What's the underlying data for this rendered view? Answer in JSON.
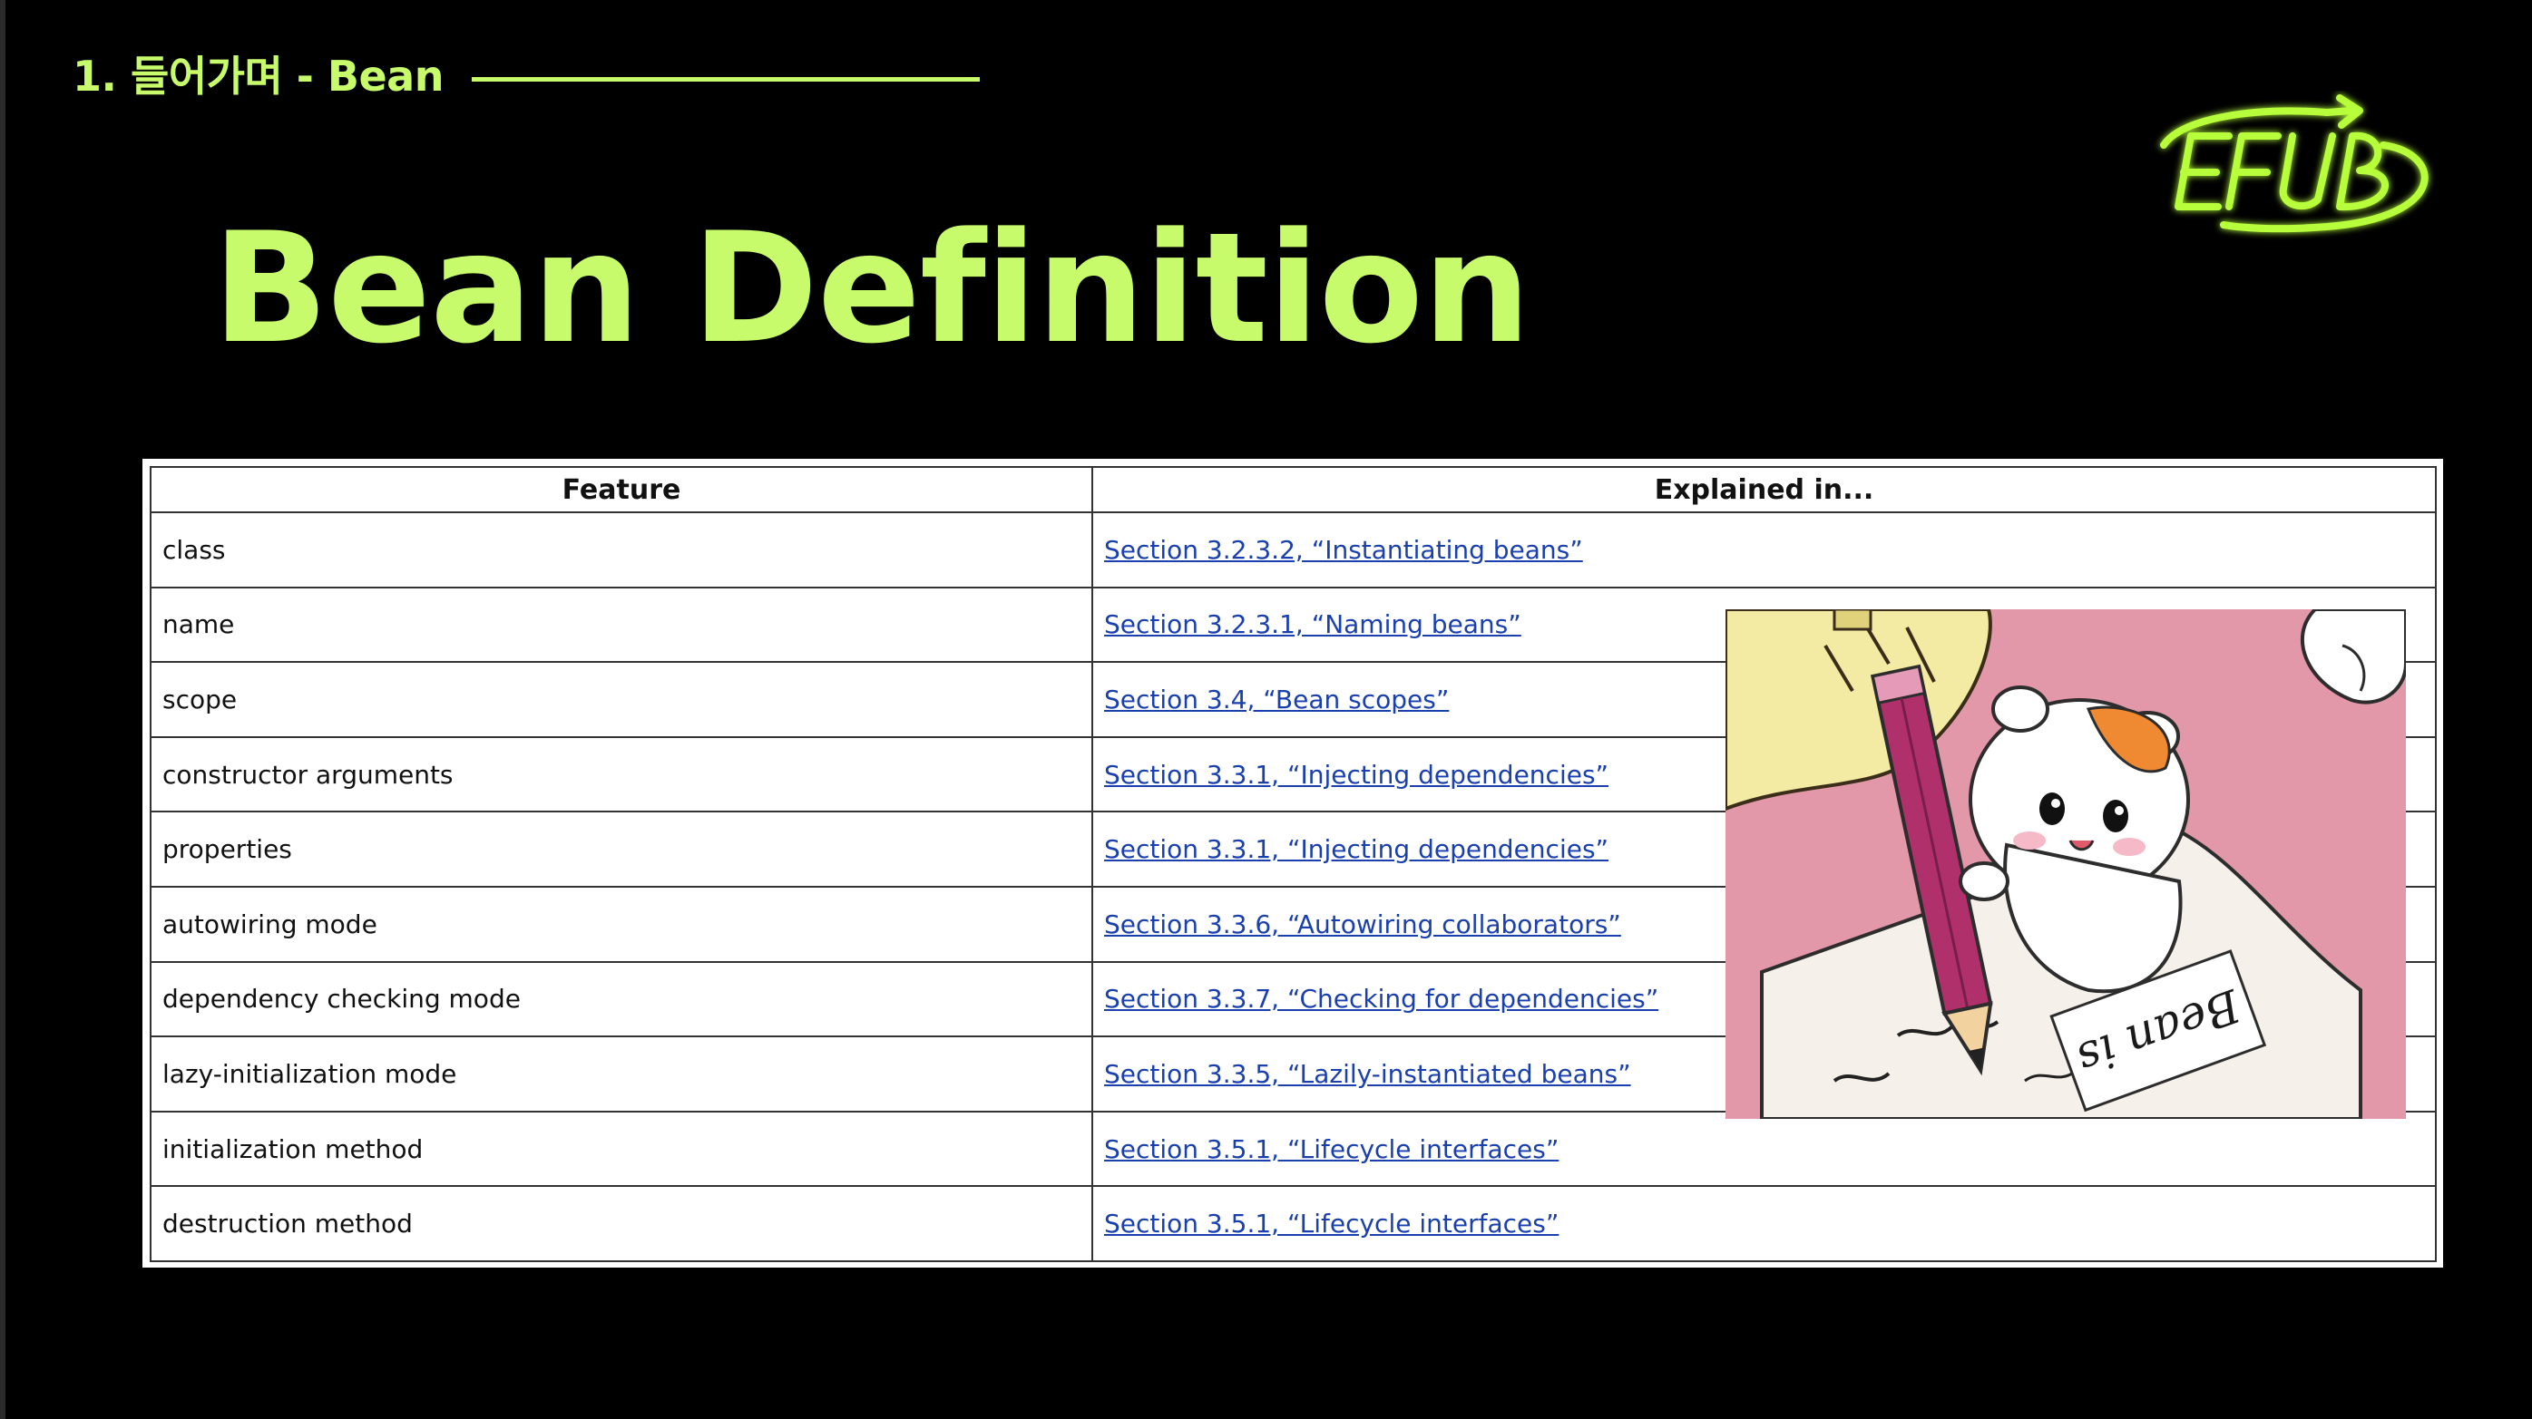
{
  "header": {
    "section_label": "1. 들어가며 - Bean",
    "title": "Bean Definition"
  },
  "logo": {
    "text": "EFUB"
  },
  "colors": {
    "accent": "#c8fb6b",
    "background": "#000000",
    "link": "#1a3fae",
    "logo_glow": "#b8ff3a"
  },
  "table": {
    "headers": [
      "Feature",
      "Explained in..."
    ],
    "rows": [
      {
        "feature": "class",
        "section": "Section 3.2.3.2, “Instantiating beans”"
      },
      {
        "feature": "name",
        "section": "Section 3.2.3.1, “Naming beans”"
      },
      {
        "feature": "scope",
        "section": "Section 3.4, “Bean scopes”"
      },
      {
        "feature": "constructor arguments",
        "section": "Section 3.3.1, “Injecting dependencies”"
      },
      {
        "feature": "properties",
        "section": "Section 3.3.1, “Injecting dependencies”"
      },
      {
        "feature": "autowiring mode",
        "section": "Section 3.3.6, “Autowiring collaborators”"
      },
      {
        "feature": "dependency checking mode",
        "section": "Section 3.3.7, “Checking for dependencies”"
      },
      {
        "feature": "lazy-initialization mode",
        "section": "Section 3.3.5, “Lazily-instantiated beans”"
      },
      {
        "feature": "initialization method",
        "section": "Section 3.5.1, “Lifecycle interfaces”"
      },
      {
        "feature": "destruction method",
        "section": "Section 3.5.1, “Lifecycle interfaces”"
      }
    ]
  },
  "illustration": {
    "subject": "hamster-writing-with-pencil",
    "note_text": "Bean is"
  }
}
